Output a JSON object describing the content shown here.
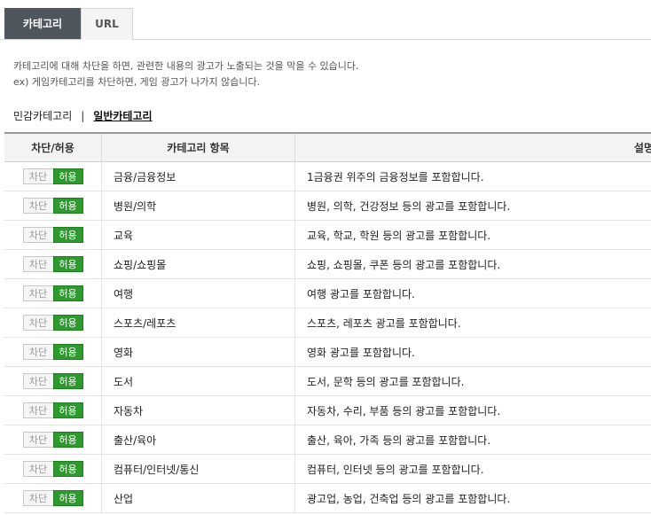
{
  "tabs": [
    {
      "label": "카테고리",
      "active": true
    },
    {
      "label": "URL",
      "active": false
    }
  ],
  "description": {
    "line1": "카테고리에 대해 차단을 하면, 관련한 내용의 광고가 노출되는 것을 막을 수 있습니다.",
    "line2": "ex) 게임카테고리를 차단하면, 게임 광고가 나가지 않습니다."
  },
  "category_types": {
    "sensitive": "민감카테고리",
    "separator": "|",
    "general": "일반카테고리"
  },
  "table": {
    "headers": [
      "차단/허용",
      "카테고리 항목",
      "설명"
    ],
    "block_label": "차단",
    "allow_label": "허용",
    "rows": [
      {
        "category": "금융/금융정보",
        "description": "1금융권 위주의 금융정보를 포함합니다.",
        "status": "allow"
      },
      {
        "category": "병원/의학",
        "description": "병원, 의학, 건강정보 등의 광고를 포함합니다.",
        "status": "allow"
      },
      {
        "category": "교육",
        "description": "교육, 학교, 학원 등의 광고를 포함합니다.",
        "status": "allow"
      },
      {
        "category": "쇼핑/쇼핑몰",
        "description": "쇼핑, 쇼핑몰, 쿠폰 등의 광고를 포함합니다.",
        "status": "allow"
      },
      {
        "category": "여행",
        "description": "여행 광고를 포함합니다.",
        "status": "allow"
      },
      {
        "category": "스포츠/레포츠",
        "description": "스포츠, 레포츠 광고를 포함합니다.",
        "status": "allow"
      },
      {
        "category": "영화",
        "description": "영화 광고를 포함합니다.",
        "status": "allow"
      },
      {
        "category": "도서",
        "description": "도서, 문학 등의 광고를 포함합니다.",
        "status": "allow"
      },
      {
        "category": "자동차",
        "description": "자동차, 수리, 부품 등의 광고를 포함합니다.",
        "status": "allow"
      },
      {
        "category": "출산/육아",
        "description": "출산, 육아, 가족 등의 광고를 포함합니다.",
        "status": "allow"
      },
      {
        "category": "컴퓨터/인터넷/통신",
        "description": "컴퓨터, 인터넷 등의 광고를 포함합니다.",
        "status": "allow"
      },
      {
        "category": "산업",
        "description": "광고업, 농업, 건축업 등의 광고를 포함합니다.",
        "status": "allow"
      }
    ]
  }
}
